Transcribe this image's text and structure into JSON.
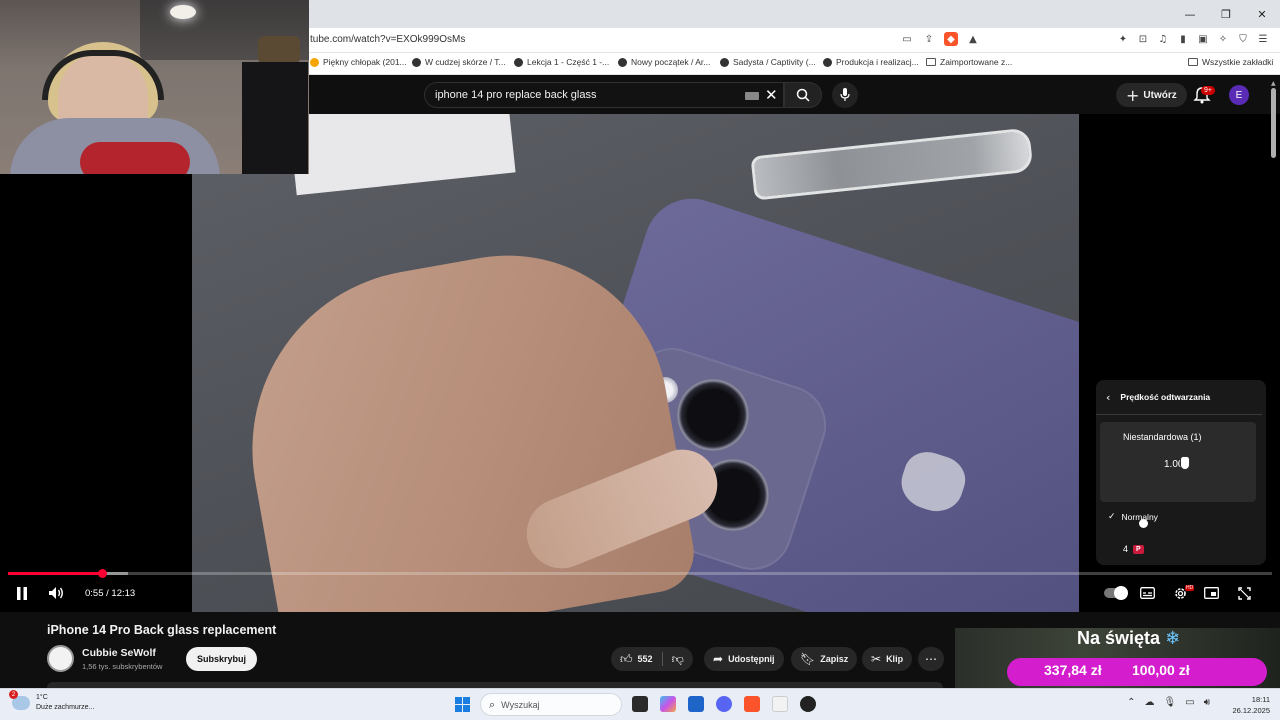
{
  "browser": {
    "url": "tube.com/watch?v=EXOk999OsMs",
    "bookmarks": [
      {
        "label": "Piękny chłopak (201..."
      },
      {
        "label": "W cudzej skórze / T..."
      },
      {
        "label": "Lekcja 1 - Część 1 -..."
      },
      {
        "label": "Nowy początek / Ar..."
      },
      {
        "label": "Sadysta / Captivity (..."
      },
      {
        "label": "Produkcja i realizacj..."
      },
      {
        "label": "Zaimportowane z..."
      }
    ],
    "all_bookmarks": "Wszystkie zakładki"
  },
  "youtube": {
    "search_query": "iphone 14 pro replace back glass",
    "create_label": "Utwórz",
    "notif_badge": "9+",
    "avatar_letter": "E"
  },
  "speed_menu": {
    "title": "Prędkość odtwarzania",
    "custom_label": "Niestandardowa (1)",
    "custom_value": "1.00",
    "normal_label": "Normalny",
    "premium_value": "4",
    "premium_badge": "P"
  },
  "player": {
    "time": "0:55 / 12:13",
    "progress_fraction": 0.075,
    "buffer_fraction": 0.095,
    "hd_badge": "HD"
  },
  "video": {
    "title": "iPhone 14 Pro Back glass replacement",
    "channel": "Cubbie SeWolf",
    "subscribers": "1,56 tys. subskrybentów",
    "subscribe_label": "Subskrybuj",
    "likes": "552",
    "share_label": "Udostępnij",
    "save_label": "Zapisz",
    "clip_label": "Klip"
  },
  "promo": {
    "title": "Na święta",
    "price1": "337,84 zł",
    "price2": "100,00 zł"
  },
  "taskbar": {
    "weather_badge": "2",
    "temperature": "1°C",
    "weather_desc": "Duże zachmurze...",
    "search_placeholder": "Wyszukaj",
    "time": "18:11",
    "date": "26.12.2025"
  },
  "colors": {
    "progress": "#ff0033",
    "brave": "#fb542b",
    "promo": "#d41dcc"
  }
}
